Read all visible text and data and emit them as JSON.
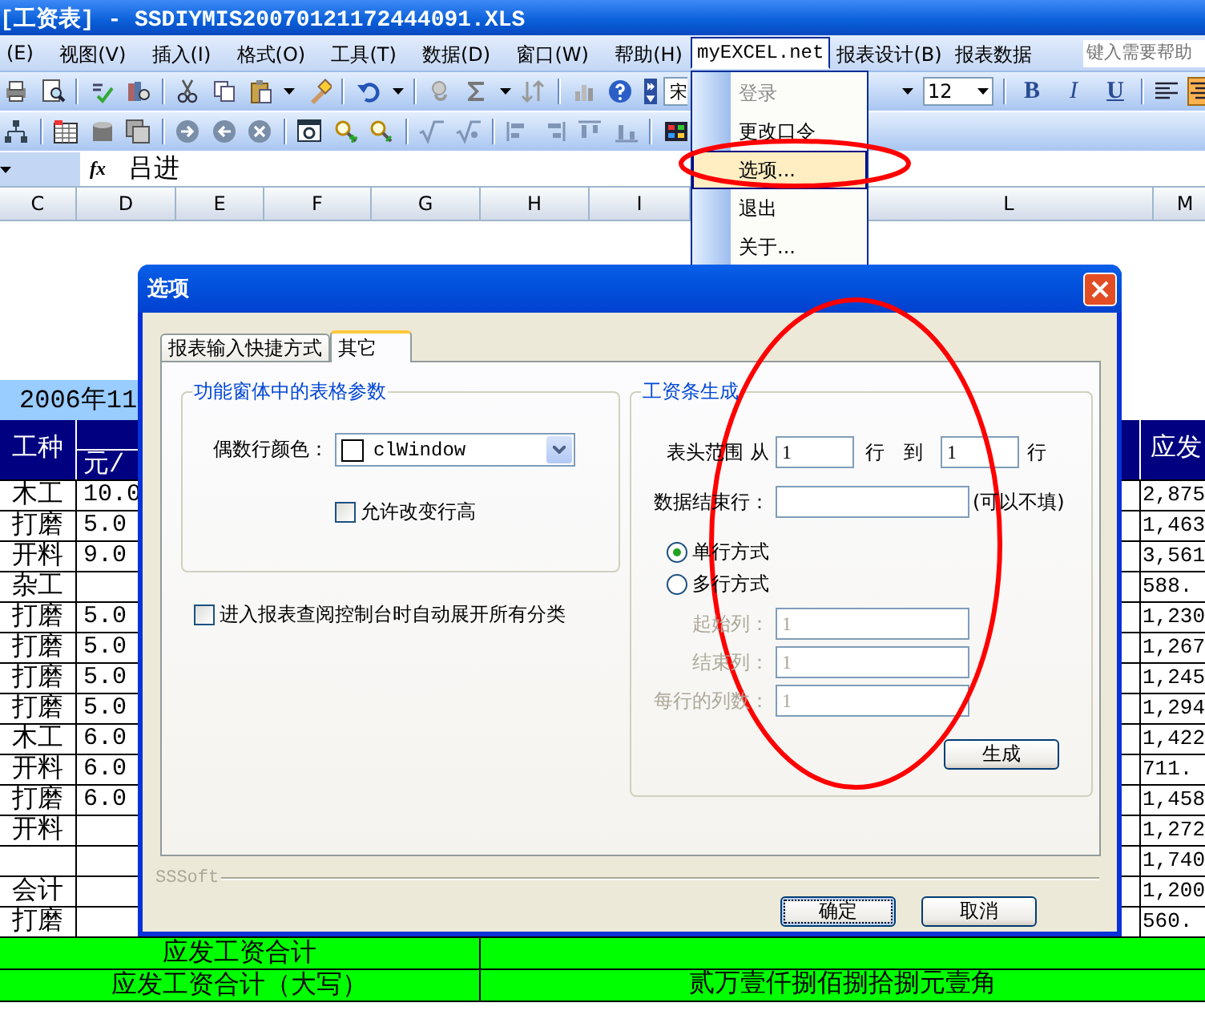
{
  "window": {
    "title": "[工资表] - SSDIYMIS20070121172444091.XLS"
  },
  "menu_bar": {
    "items": [
      {
        "label": "(E)",
        "open": false
      },
      {
        "label": "视图(V)",
        "open": false
      },
      {
        "label": "插入(I)",
        "open": false
      },
      {
        "label": "格式(O)",
        "open": false
      },
      {
        "label": "工具(T)",
        "open": false
      },
      {
        "label": "数据(D)",
        "open": false
      },
      {
        "label": "窗口(W)",
        "open": false
      },
      {
        "label": "帮助(H)",
        "open": false
      },
      {
        "label": "myEXCEL.net",
        "open": true
      },
      {
        "label": "报表设计(B)",
        "open": false
      },
      {
        "label": "报表数据",
        "open": false
      }
    ],
    "help_placeholder": "键入需要帮助"
  },
  "toolbar": {
    "font_name": "宋",
    "font_size": "12",
    "format_buttons": [
      {
        "label": "B",
        "kind": "bold"
      },
      {
        "label": "I",
        "kind": "italic"
      },
      {
        "label": "U",
        "kind": "underline"
      }
    ]
  },
  "formula_bar": {
    "fx": "fx",
    "value": "吕进"
  },
  "column_headers": [
    "C",
    "D",
    "E",
    "F",
    "G",
    "H",
    "I",
    "L",
    "M"
  ],
  "sheet": {
    "title": "2006年11",
    "headers": {
      "job": "工种",
      "column_2_sub": "元/",
      "pay": "应发"
    },
    "rows": [
      {
        "job": "木工",
        "column_2": "10.0",
        "pay": "2,875"
      },
      {
        "job": "打磨",
        "column_2": "5.0",
        "pay": "1,463"
      },
      {
        "job": "开料",
        "column_2": "9.0",
        "pay": "3,561"
      },
      {
        "job": "杂工",
        "pay": "588."
      },
      {
        "job": "打磨",
        "column_2": "5.0",
        "pay": "1,230"
      },
      {
        "job": "打磨",
        "column_2": "5.0",
        "pay": "1,267"
      },
      {
        "job": "打磨",
        "column_2": "5.0",
        "pay": "1,245"
      },
      {
        "job": "打磨",
        "column_2": "5.0",
        "pay": "1,294"
      },
      {
        "job": "木工",
        "column_2": "6.0",
        "pay": "1,422"
      },
      {
        "job": "开料",
        "column_2": "6.0",
        "pay": "711."
      },
      {
        "job": "打磨",
        "column_2": "6.0",
        "pay": "1,458"
      },
      {
        "job": "开料",
        "pay": "1,272"
      },
      {
        "pay": "1,740"
      },
      {
        "job": "会计",
        "pay": "1,200"
      },
      {
        "job": "打磨",
        "pay": "560."
      }
    ],
    "total_rows": [
      {
        "label": "应发工资合计"
      },
      {
        "label": "应发工资合计（大写）",
        "value": "贰万壹仟捌佰捌拾捌元壹角"
      }
    ]
  },
  "dropdown_menu": {
    "items": [
      {
        "label": "登录",
        "disabled": true,
        "selected": false
      },
      {
        "label": "更改口令",
        "disabled": false,
        "selected": false
      },
      {
        "label": "选项...",
        "disabled": false,
        "selected": true
      },
      {
        "label": "退出",
        "disabled": false,
        "selected": false
      },
      {
        "label": "关于...",
        "disabled": false,
        "selected": false
      }
    ]
  },
  "dialog": {
    "title": "选项",
    "tabs": [
      {
        "label": "报表输入快捷方式",
        "selected": false
      },
      {
        "label": "其它",
        "selected": true
      }
    ],
    "grid_group": {
      "title": "功能窗体中的表格参数",
      "even_row_color_label": "偶数行颜色：",
      "even_row_color": "clWindow",
      "allow_row_height": {
        "label": "允许改变行高",
        "checked": false
      }
    },
    "expand_all": {
      "label": "进入报表查阅控制台时自动展开所有分类",
      "checked": false
    },
    "payslip_group": {
      "title": "工资条生成",
      "header_range_label": "表头范围 从",
      "from": "1",
      "row_label_1": "行",
      "to_label": "到",
      "to": "1",
      "row_label_2": "行",
      "data_end_label": "数据结束行：",
      "optional_note": "(可以不填)",
      "modes": [
        {
          "label": "单行方式",
          "selected": true
        },
        {
          "label": "多行方式",
          "selected": false
        }
      ],
      "fields": [
        {
          "label": "起始列：",
          "value": "1",
          "disabled": true
        },
        {
          "label": "结束列：",
          "value": "1",
          "disabled": true
        },
        {
          "label": "每行的列数：",
          "value": "1",
          "disabled": true
        }
      ],
      "generate_button": "生成"
    },
    "footer": "SSSoft",
    "buttons": [
      {
        "label": "确定",
        "focused": true
      },
      {
        "label": "取消",
        "focused": false
      }
    ]
  }
}
